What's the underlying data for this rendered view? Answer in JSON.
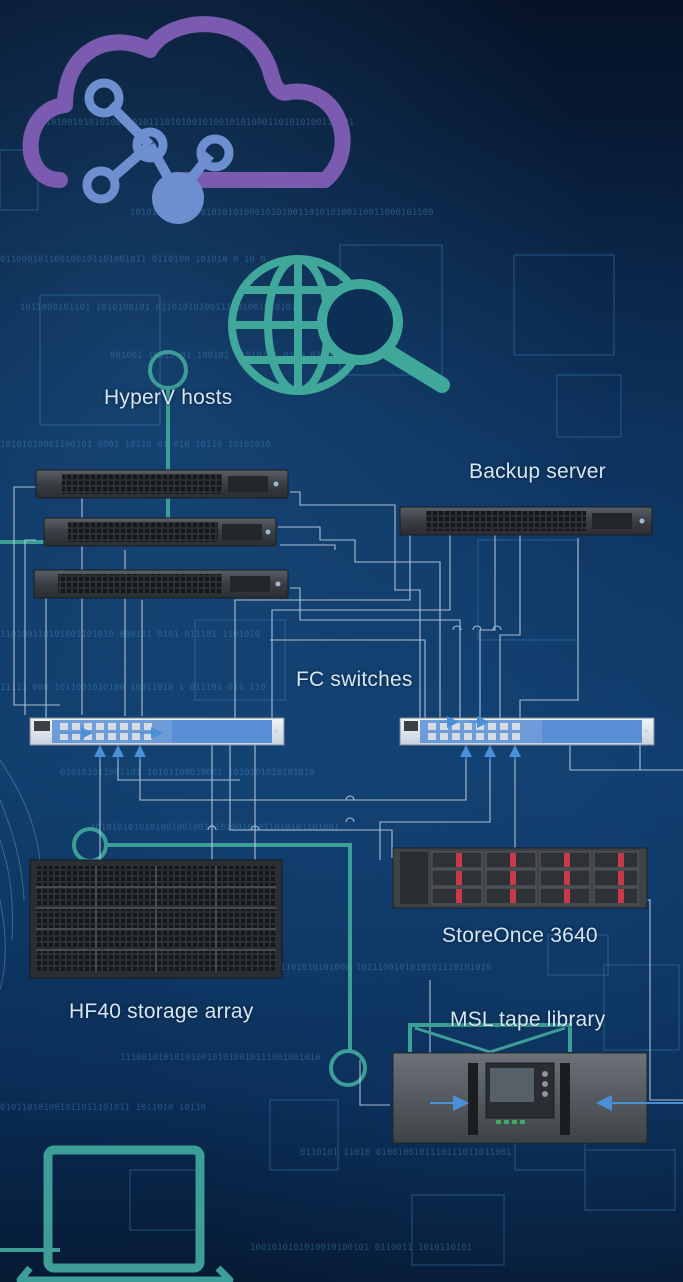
{
  "labels": {
    "hyperv_hosts": "HyperV hosts",
    "backup_server": "Backup server",
    "fc_switches": "FC switches",
    "storeonce": "StoreOnce 3640",
    "storage_array": "HF40 storage array",
    "tape_library": "MSL tape library"
  },
  "colors": {
    "cloud_outline": "#7a5bb0",
    "network_icon": "#6d8fd0",
    "globe_icon": "#3fa89a",
    "teal_line": "#3c9e96",
    "connector_line": "#c8d6e6",
    "arrow": "#4a8fd8",
    "switch_blue": "#5a8fd6",
    "drive_red": "#c83a48"
  },
  "icons": [
    "cloud-network-icon",
    "globe-search-icon",
    "laptop-icon"
  ]
}
